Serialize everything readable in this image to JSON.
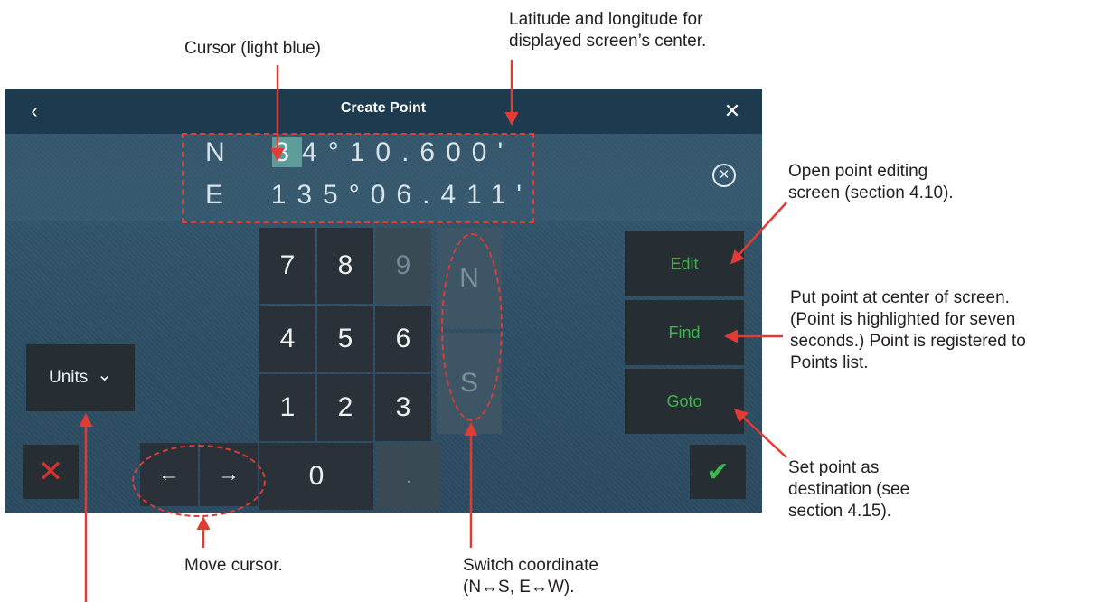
{
  "annotations": {
    "cursor": "Cursor (light blue)",
    "latlon_line1": "Latitude and longitude for",
    "latlon_line2": "displayed screen’s center.",
    "edit_line1": "Open point editing",
    "edit_line2": "screen (section 4.10).",
    "find_line1": "Put point at center of screen.",
    "find_line2": "(Point is highlighted for seven",
    "find_line3": "seconds.) Point is registered to",
    "find_line4": "Points list.",
    "goto_line1": "Set point as",
    "goto_line2": "destination (see",
    "goto_line3": "section 4.15).",
    "move_cursor": "Move cursor.",
    "switch_line1": "Switch coordinate",
    "switch_line2": "(N↔S, E↔W)."
  },
  "dialog": {
    "title": "Create Point",
    "back_icon": "‹",
    "close_icon": "✕",
    "clear_icon": "✕",
    "latitude": {
      "hemisphere": "N",
      "cursor_digit": "3",
      "rest": "4°10.600'"
    },
    "longitude": {
      "hemisphere": "E",
      "value": "135°06.411'"
    }
  },
  "keypad": {
    "k7": "7",
    "k8": "8",
    "k9": "9",
    "k4": "4",
    "k5": "5",
    "k6": "6",
    "k1": "1",
    "k2": "2",
    "k3": "3",
    "k0": "0",
    "dot": ".",
    "north": "N",
    "south": "S",
    "left_arrow": "←",
    "right_arrow": "→"
  },
  "buttons": {
    "edit": "Edit",
    "find": "Find",
    "goto": "Goto",
    "units": "Units",
    "units_chevron": "⌄",
    "cancel": "✕",
    "confirm": "✔"
  },
  "colors": {
    "accent_green": "#3eb54a",
    "cancel_red": "#d6332f",
    "annotation_red": "#e23b33",
    "cursor_highlight": "#5c9c99"
  }
}
